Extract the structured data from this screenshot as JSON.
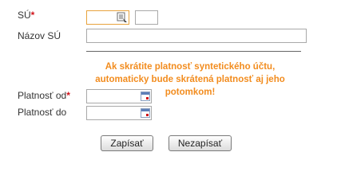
{
  "form": {
    "su": {
      "label": "SÚ",
      "required_mark": "*",
      "value": "",
      "code_value": ""
    },
    "nazov_su": {
      "label": "Názov SÚ",
      "value": ""
    },
    "warning": "Ak skrátite platnosť syntetického účtu, automaticky bude skrátená platnosť aj jeho potomkom!",
    "platnost_od": {
      "label": "Platnosť od",
      "required_mark": "*",
      "value": ""
    },
    "platnost_do": {
      "label": "Platnosť do",
      "value": ""
    }
  },
  "buttons": {
    "save_label": "Zapísať",
    "cancel_label": "Nezapísať"
  },
  "colors": {
    "required": "#d0121a",
    "warning": "#f28c1e",
    "focus_border": "#e8a33d"
  }
}
